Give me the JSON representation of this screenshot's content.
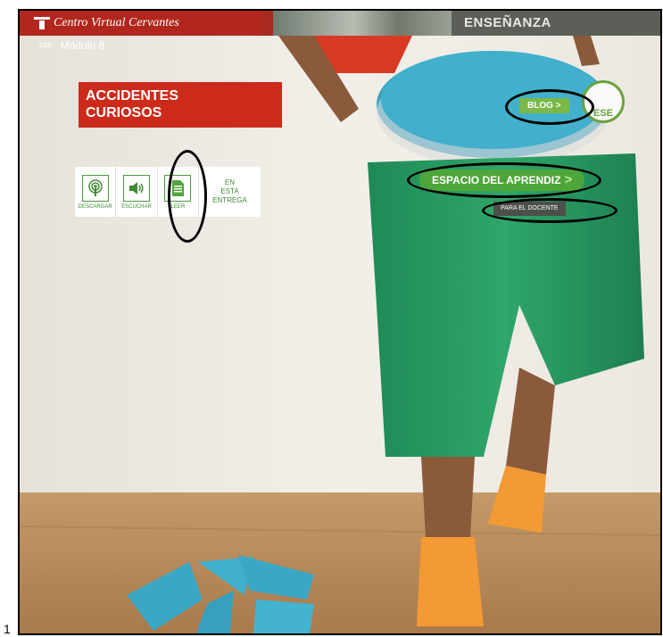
{
  "header": {
    "brand": "Centro Virtual Cervantes",
    "section": "ENSEÑANZA"
  },
  "breadcrumb": {
    "prefix": "ESE ›",
    "label": "Módulo 8"
  },
  "title": {
    "line1": "ACCIDENTES",
    "line2": "CURIOSOS"
  },
  "toolbar": {
    "items": [
      {
        "label": "DESCARGAR",
        "icon": "podcast-icon"
      },
      {
        "label": "ESCUCHAR",
        "icon": "speaker-icon"
      },
      {
        "label": "LEER",
        "icon": "document-icon"
      }
    ],
    "entrega": {
      "line1": "EN",
      "line2": "ESTA",
      "line3": "ENTREGA"
    }
  },
  "links": {
    "blog": "BLOG >",
    "espacio": "ESPACIO DEL APRENDIZ",
    "espacio_chevron": ">",
    "docente": "PARA EL DOCENTE"
  },
  "logo": {
    "text": "ESE"
  },
  "figure_number": "1",
  "colors": {
    "brand_red": "#b1271d",
    "title_red": "#cc2a1a",
    "green": "#4ea63a",
    "dark_grey": "#4d4f4a"
  }
}
